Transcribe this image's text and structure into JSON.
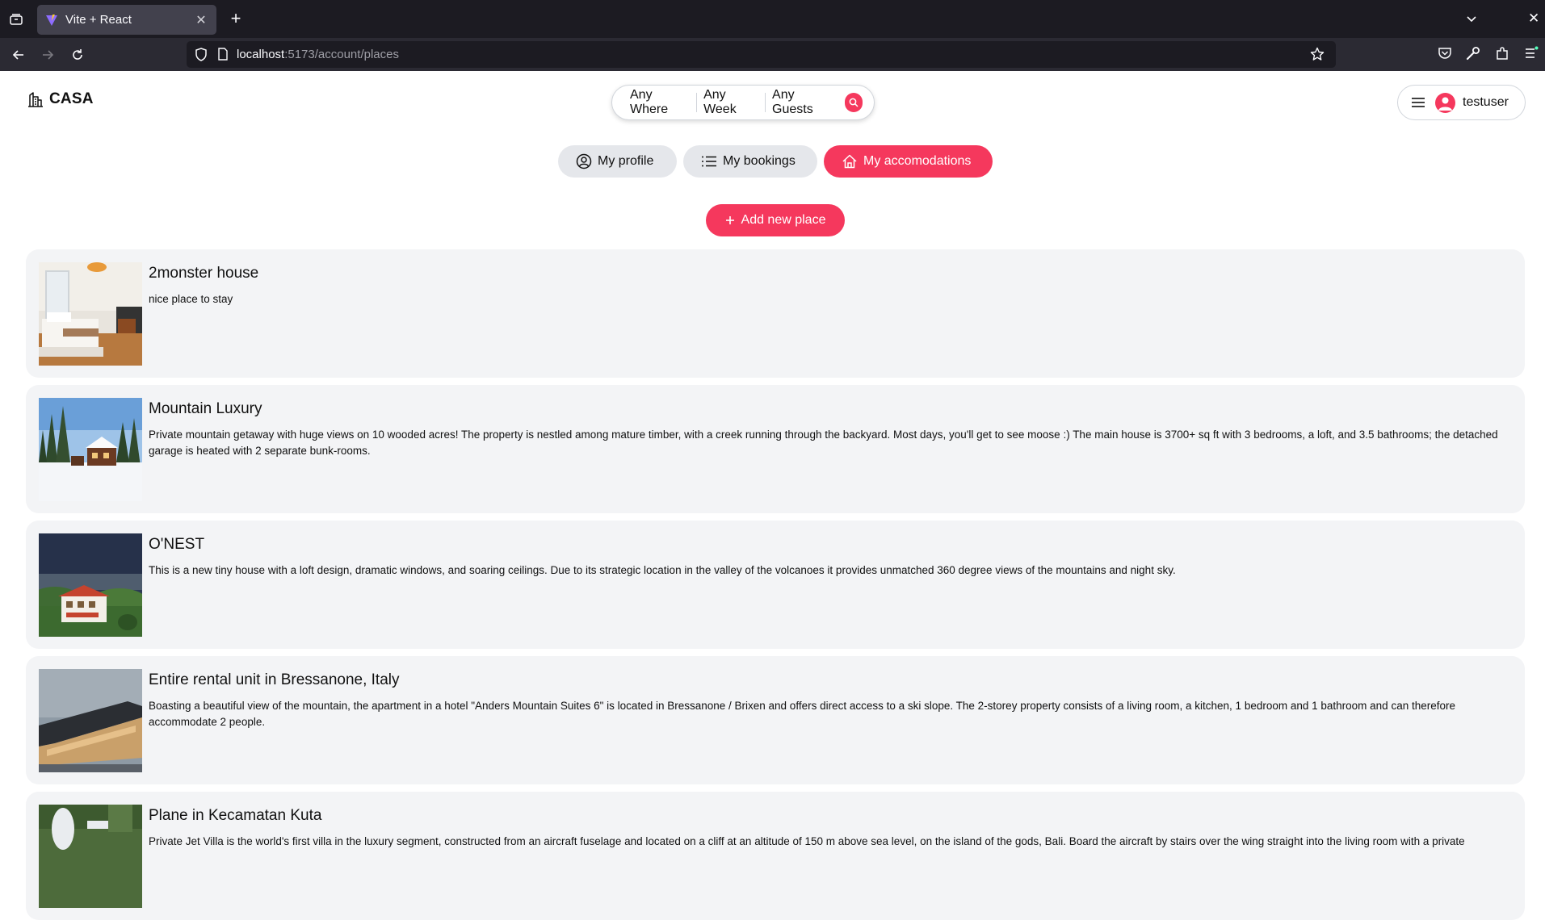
{
  "browser": {
    "tab_title": "Vite + React",
    "url_host": "localhost",
    "url_path": ":5173/account/places"
  },
  "header": {
    "logo_text": "CASA",
    "search": {
      "where": "Any Where",
      "week": "Any Week",
      "guests": "Any Guests"
    },
    "user": {
      "name": "testuser"
    }
  },
  "account_nav": {
    "profile": "My profile",
    "bookings": "My bookings",
    "accommodations": "My accomodations"
  },
  "add_button": "Add new place",
  "places": [
    {
      "title": "2monster house",
      "description": "nice place to stay"
    },
    {
      "title": "Mountain Luxury",
      "description": "Private mountain getaway with huge views on 10 wooded acres! The property is nestled among mature timber, with a creek running through the backyard. Most days, you'll get to see moose :) The main house is 3700+ sq ft with 3 bedrooms, a loft, and 3.5 bathrooms; the detached garage is heated with 2 separate bunk-rooms."
    },
    {
      "title": "O'NEST",
      "description": "This is a new tiny house with a loft design, dramatic windows, and soaring ceilings. Due to its strategic location in the valley of the volcanoes it provides unmatched 360 degree views of the mountains and night sky."
    },
    {
      "title": "Entire rental unit in Bressanone, Italy",
      "description": "Boasting a beautiful view of the mountain, the apartment in a hotel \"Anders Mountain Suites 6\" is located in Bressanone / Brixen and offers direct access to a ski slope. The 2-storey property consists of a living room, a kitchen, 1 bedroom and 1 bathroom and can therefore accommodate 2 people."
    },
    {
      "title": "Plane in Kecamatan Kuta",
      "description": "Private Jet Villa is the world's first villa in the luxury segment, constructed from an aircraft fuselage and located on a cliff at an altitude of 150 m above sea level, on the island of the gods, Bali. Board the aircraft by stairs over the wing straight into the living room with a private"
    }
  ],
  "colors": {
    "accent": "#f5385d",
    "card_bg": "#f3f4f6",
    "pill_bg": "#e5e7eb"
  }
}
